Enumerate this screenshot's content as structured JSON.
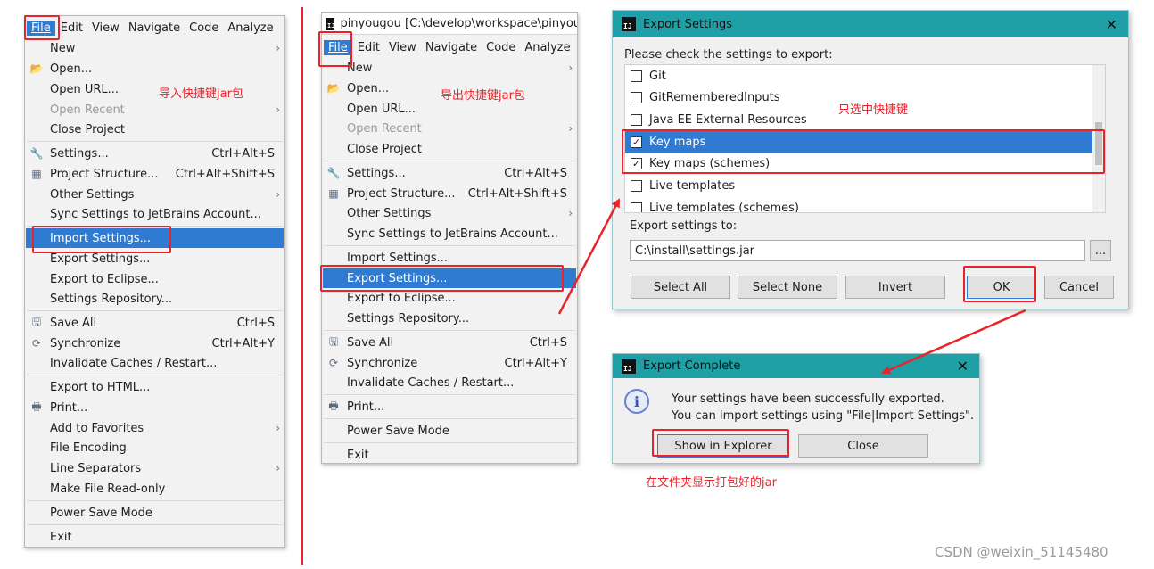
{
  "menu1": {
    "menubar": [
      "File",
      "Edit",
      "View",
      "Navigate",
      "Code",
      "Analyze"
    ],
    "items": [
      {
        "label": "New",
        "arrow": "›"
      },
      {
        "label": "Open...",
        "icon": "folder-open-icon"
      },
      {
        "label": "Open URL..."
      },
      {
        "label": "Open Recent",
        "arrow": "›",
        "disabled": true
      },
      {
        "label": "Close Project"
      },
      {
        "label": "Settings...",
        "shortcut": "Ctrl+Alt+S",
        "icon": "wrench-icon"
      },
      {
        "label": "Project Structure...",
        "shortcut": "Ctrl+Alt+Shift+S",
        "icon": "project-structure-icon"
      },
      {
        "label": "Other Settings",
        "arrow": "›"
      },
      {
        "label": "Sync Settings to JetBrains Account..."
      },
      {
        "label": "Import Settings...",
        "highlight": true
      },
      {
        "label": "Export Settings..."
      },
      {
        "label": "Export to Eclipse..."
      },
      {
        "label": "Settings Repository..."
      },
      {
        "label": "Save All",
        "shortcut": "Ctrl+S",
        "icon": "save-icon"
      },
      {
        "label": "Synchronize",
        "shortcut": "Ctrl+Alt+Y",
        "icon": "sync-icon"
      },
      {
        "label": "Invalidate Caches / Restart..."
      },
      {
        "label": "Export to HTML..."
      },
      {
        "label": "Print...",
        "icon": "print-icon"
      },
      {
        "label": "Add to Favorites",
        "arrow": "›"
      },
      {
        "label": "File Encoding"
      },
      {
        "label": "Line Separators",
        "arrow": "›"
      },
      {
        "label": "Make File Read-only"
      },
      {
        "label": "Power Save Mode"
      },
      {
        "label": "Exit"
      }
    ],
    "note": "导入快捷键jar包"
  },
  "menu2": {
    "window_title": "pinyougou [C:\\develop\\workspace\\pinyou",
    "menubar": [
      "File",
      "Edit",
      "View",
      "Navigate",
      "Code",
      "Analyze"
    ],
    "items": [
      {
        "label": "New",
        "arrow": "›"
      },
      {
        "label": "Open...",
        "icon": "folder-open-icon"
      },
      {
        "label": "Open URL..."
      },
      {
        "label": "Open Recent",
        "arrow": "›",
        "disabled": true
      },
      {
        "label": "Close Project"
      },
      {
        "label": "Settings...",
        "shortcut": "Ctrl+Alt+S",
        "icon": "wrench-icon"
      },
      {
        "label": "Project Structure...",
        "shortcut": "Ctrl+Alt+Shift+S",
        "icon": "project-structure-icon"
      },
      {
        "label": "Other Settings",
        "arrow": "›"
      },
      {
        "label": "Sync Settings to JetBrains Account..."
      },
      {
        "label": "Import Settings..."
      },
      {
        "label": "Export Settings...",
        "highlight": true
      },
      {
        "label": "Export to Eclipse..."
      },
      {
        "label": "Settings Repository..."
      },
      {
        "label": "Save All",
        "shortcut": "Ctrl+S",
        "icon": "save-icon"
      },
      {
        "label": "Synchronize",
        "shortcut": "Ctrl+Alt+Y",
        "icon": "sync-icon"
      },
      {
        "label": "Invalidate Caches / Restart..."
      },
      {
        "label": "Print...",
        "icon": "print-icon"
      },
      {
        "label": "Power Save Mode"
      },
      {
        "label": "Exit"
      }
    ],
    "note": "导出快捷键jar包"
  },
  "export_dialog": {
    "title": "Export Settings",
    "close": "✕",
    "prompt": "Please check the settings to export:",
    "items": [
      {
        "label": "Git",
        "checked": false
      },
      {
        "label": "GitRememberedInputs",
        "checked": false
      },
      {
        "label": "Java EE External Resources",
        "checked": false
      },
      {
        "label": "Key maps",
        "checked": true,
        "selected": true
      },
      {
        "label": "Key maps (schemes)",
        "checked": true
      },
      {
        "label": "Live templates",
        "checked": false
      },
      {
        "label": "Live templates (schemes)",
        "checked": false
      }
    ],
    "note": "只选中快捷键",
    "export_to_label": "Export settings to:",
    "path_value": "C:\\install\\settings.jar",
    "browse_label": "...",
    "buttons": {
      "select_all": "Select All",
      "select_none": "Select None",
      "invert": "Invert",
      "ok": "OK",
      "cancel": "Cancel"
    }
  },
  "complete_dialog": {
    "title": "Export Complete",
    "close": "✕",
    "line1": "Your settings have been successfully exported.",
    "line2": "You can import settings using \"File|Import Settings\".",
    "buttons": {
      "show_in_explorer": "Show in Explorer",
      "close": "Close"
    },
    "note": "在文件夹显示打包好的jar"
  },
  "watermark": "CSDN @weixin_51145480",
  "colors": {
    "accent": "#2e7bd1",
    "dialog_title": "#1fa0a7",
    "annotation": "#e8232a"
  }
}
